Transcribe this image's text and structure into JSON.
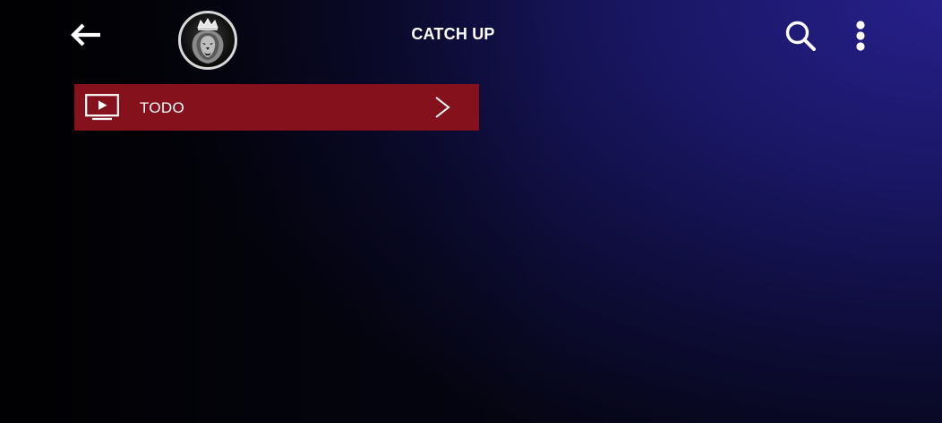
{
  "header": {
    "title": "CATCH UP",
    "back_icon": "arrow-left-icon",
    "logo_icon": "lion-crown-logo",
    "search_icon": "search-icon",
    "menu_icon": "more-vertical-icon"
  },
  "categories": [
    {
      "label": "TODO",
      "icon": "tv-play-icon",
      "trailing_icon": "chevron-right-icon"
    }
  ],
  "colors": {
    "item_background": "#85111c",
    "background_accent": "#26208a",
    "text": "#ffffff"
  }
}
